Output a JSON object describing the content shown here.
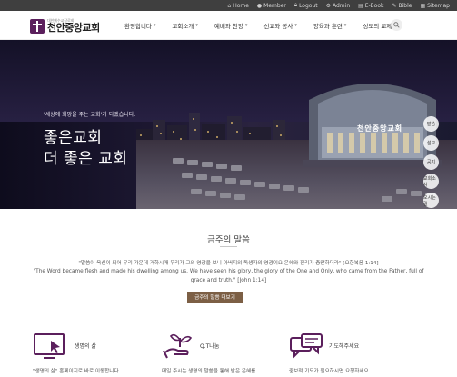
{
  "topbar": {
    "links": [
      {
        "label": "Home",
        "icon": "home-icon"
      },
      {
        "label": "Member",
        "icon": "user-icon"
      },
      {
        "label": "Logout",
        "icon": "lock-icon"
      },
      {
        "label": "Admin",
        "icon": "gear-icon"
      },
      {
        "label": "E-Book",
        "icon": "book-icon"
      },
      {
        "label": "Bible",
        "icon": "pen-icon"
      },
      {
        "label": "Sitemap",
        "icon": "sitemap-icon"
      }
    ]
  },
  "logo": {
    "subtitle": "대한예수교장로회",
    "name": "천안중앙교회"
  },
  "nav": {
    "items": [
      {
        "label": "환영합니다"
      },
      {
        "label": "교회소개"
      },
      {
        "label": "예배와 찬양"
      },
      {
        "label": "선교와 봉사"
      },
      {
        "label": "양육과 훈련"
      },
      {
        "label": "성도의 교제"
      }
    ],
    "search_icon": "search-icon"
  },
  "hero": {
    "subtitle": "'세상에 희망을 주는 교회'가 되겠습니다.",
    "line1": "좋은교회",
    "line2": "더 좋은 교회",
    "building_sign": "천안중앙교회",
    "quick_links": [
      "말씀",
      "설교",
      "공지",
      "교회소식",
      "오시는길"
    ]
  },
  "word": {
    "title": "금주의 말씀",
    "korean": "\"말씀이 육신이 되어 우리 가운데 거하시매 우리가 그의 영광을 보니 아버지의 독생자의 영광이요 은혜와 진리가 충만하더라\" [요한복음 1:14]",
    "english_line1": "\"The Word became flesh and made his dwelling among us. We have seen his glory, the glory of the One and Only, who came from the Father, full of",
    "english_line2": "grace and truth.\" [John 1:14]",
    "button_label": "금주의 말씀 더보기"
  },
  "features": [
    {
      "title": "생명의 삶",
      "desc": "\"생명의 삶\" 홈페이지로 바로 이동합니다.",
      "icon": "monitor-cursor-icon"
    },
    {
      "title": "Q.T나눔",
      "desc": "매일 주시는 생명의 말씀을 통해 받은 은혜를",
      "icon": "hand-plant-icon"
    },
    {
      "title": "기도해주세요",
      "desc": "중보적 기도가 필요하시면 요청하세요.",
      "icon": "chat-bubbles-icon"
    }
  ],
  "colors": {
    "accent": "#5b1f5c",
    "button": "#7c5f45",
    "topbar": "#3f3f3f"
  }
}
